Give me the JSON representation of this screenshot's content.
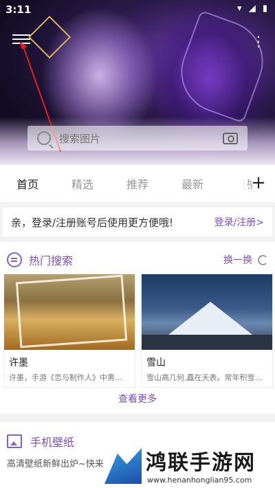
{
  "status": {
    "time": "3:11",
    "icons": [
      "wifi-icon",
      "signal-icon",
      "battery-icon"
    ]
  },
  "header": {
    "menu_icon": "hamburger-menu-icon",
    "actions_icon": "more-icon"
  },
  "search": {
    "placeholder": "搜索图片",
    "icon": "search-icon",
    "camera_icon": "camera-icon"
  },
  "tabs": {
    "items": [
      {
        "label": "首页",
        "active": true
      },
      {
        "label": "精选",
        "active": false
      },
      {
        "label": "推荐",
        "active": false
      },
      {
        "label": "最新",
        "active": false
      },
      {
        "label": "热",
        "active": false
      }
    ],
    "add_icon": "plus-icon"
  },
  "login_prompt": {
    "text": "亲，登录/注册账号后使用更方便哦!",
    "link": "登录/注册>"
  },
  "hot_search": {
    "title": "热门搜索",
    "refresh_label": "换一换",
    "cards": [
      {
        "title": "许墨",
        "desc": "许墨，手游《恋与制作人》中男…"
      },
      {
        "title": "雪山",
        "desc": "雪山高几何,矗在天表。常年积雪…"
      }
    ],
    "more_label": "查看更多"
  },
  "wallpaper": {
    "title": "手机壁纸",
    "desc": "高清壁纸新鲜出炉~快来"
  },
  "watermark": {
    "name": "鸿联手游网",
    "url": "www.henanhonglian95.com"
  },
  "colors": {
    "accent": "#7b4fc0",
    "arrow": "#e02020"
  }
}
